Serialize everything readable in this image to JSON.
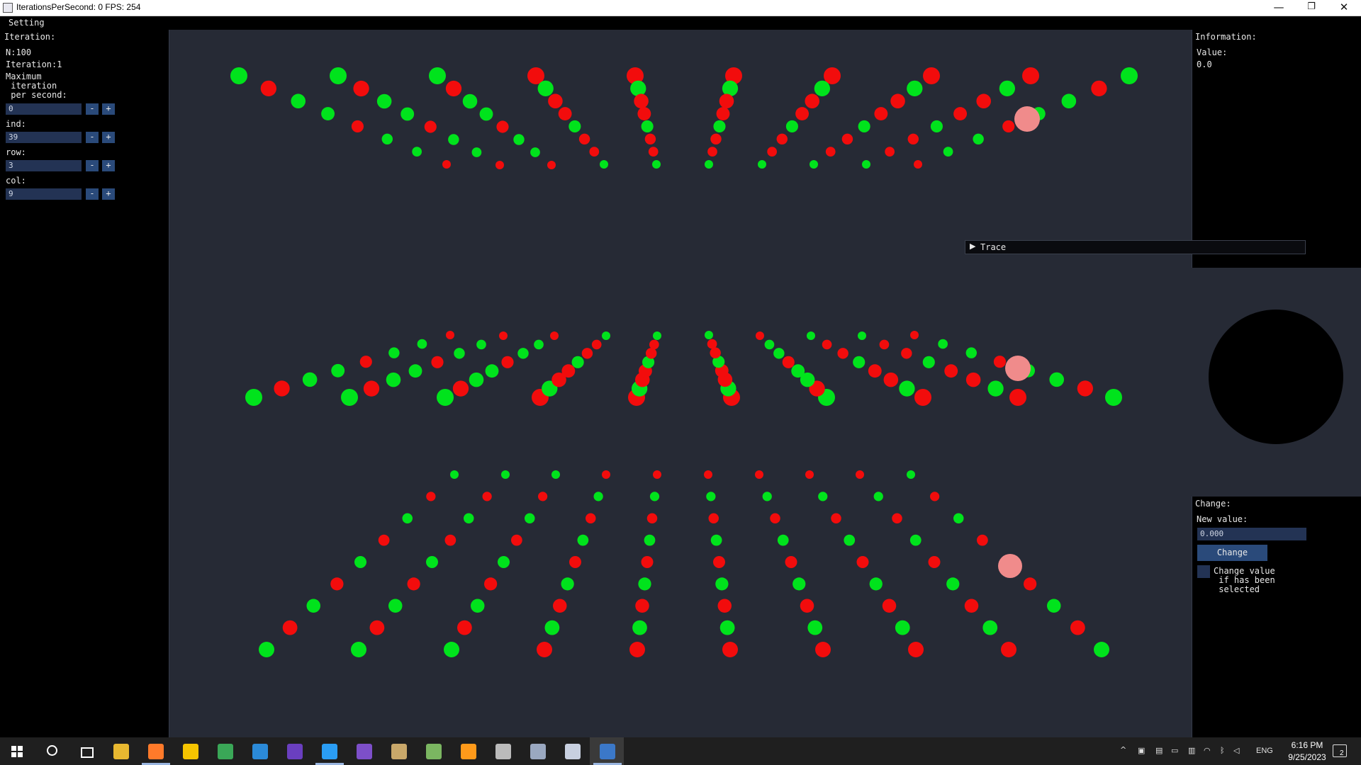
{
  "window": {
    "title": "IterationsPerSecond: 0 FPS: 254",
    "minimize": "—",
    "restore": "❐",
    "close": "✕"
  },
  "menu": {
    "setting": "Setting"
  },
  "left_panel": {
    "header": "Iteration:",
    "n_label": "N:100",
    "iteration_label": "Iteration:1",
    "max_label": "Maximum\n iteration\n per second:",
    "fields": [
      {
        "label": "",
        "value": "0"
      },
      {
        "label": "ind:",
        "value": "39"
      },
      {
        "label": "row:",
        "value": "3"
      },
      {
        "label": "col:",
        "value": "9"
      }
    ],
    "minus": "-",
    "plus": "+"
  },
  "info_panel": {
    "header": "Information:",
    "value_label": "Value:",
    "value": "0.0"
  },
  "trace": {
    "arrow": "▶",
    "label": "Trace"
  },
  "change_panel": {
    "header": "Change:",
    "new_value_label": "New value:",
    "new_value": "0.000",
    "button": "Change",
    "checkbox_label": "Change value\n if has been\n selected"
  },
  "colors": {
    "green": "#00e31c",
    "red": "#f20c0c",
    "pink": "#f08b8b",
    "canvas": "#262a35",
    "panel": "#000000"
  },
  "taskbar": {
    "icons": [
      "windows-start-icon",
      "search-icon",
      "task-view-icon",
      "file-explorer-icon",
      "firefox-icon",
      "player-icon",
      "chrome-icon",
      "remote-desktop-icon",
      "visual-studio-icon",
      "vscode-icon",
      "visual-studio-preview-icon",
      "installer-icon",
      "notepad-icon",
      "sublime-icon",
      "calculator-icon",
      "tool-icon",
      "terminal-icon",
      "python-app-icon"
    ],
    "language": "ENG",
    "time": "6:16 PM",
    "date": "9/25/2023",
    "notifications": "2"
  }
}
